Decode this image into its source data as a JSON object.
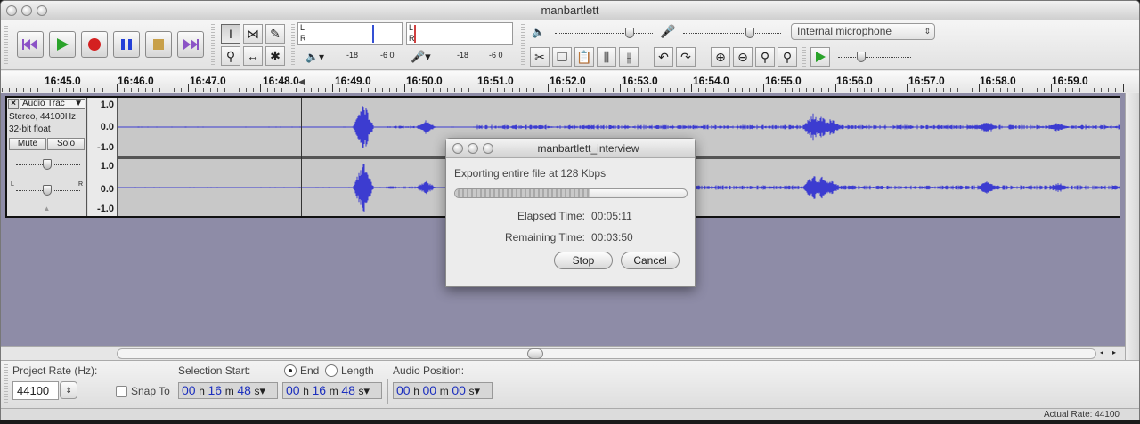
{
  "window": {
    "title": "manbartlett"
  },
  "meters": {
    "left": "L",
    "right": "R",
    "db18": "-18",
    "db6": "-6 0"
  },
  "mixer": {
    "input_source": "Internal microphone"
  },
  "ruler": {
    "ticks": [
      "16:45.0",
      "16:46.0",
      "16:47.0",
      "16:48.0",
      "16:49.0",
      "16:50.0",
      "16:51.0",
      "16:52.0",
      "16:53.0",
      "16:54.0",
      "16:55.0",
      "16:56.0",
      "16:57.0",
      "16:58.0",
      "16:59.0"
    ]
  },
  "track": {
    "name": "Audio Trac",
    "info1": "Stereo, 44100Hz",
    "info2": "32-bit float",
    "mute": "Mute",
    "solo": "Solo",
    "pan_l": "L",
    "pan_r": "R",
    "vruler": [
      "1.0",
      "0.0",
      "-1.0",
      "1.0",
      "0.0",
      "-1.0"
    ]
  },
  "dialog": {
    "title": "manbartlett_interview",
    "message": "Exporting entire file at 128 Kbps",
    "progress": 0.58,
    "elapsed_label": "Elapsed Time:",
    "elapsed_value": "00:05:11",
    "remaining_label": "Remaining Time:",
    "remaining_value": "00:03:50",
    "stop": "Stop",
    "cancel": "Cancel"
  },
  "selection": {
    "project_rate_label": "Project Rate (Hz):",
    "project_rate": "44100",
    "snap_to": "Snap To",
    "selection_start_label": "Selection Start:",
    "end_label": "End",
    "length_label": "Length",
    "audio_position_label": "Audio Position:",
    "start": {
      "h": "00",
      "m": "16",
      "s": "48"
    },
    "end": {
      "h": "00",
      "m": "16",
      "s": "48"
    },
    "position": {
      "h": "00",
      "m": "00",
      "s": "00"
    },
    "unit_h": "h",
    "unit_m": "m",
    "unit_s": "s"
  },
  "status": {
    "actual_rate": "Actual Rate: 44100"
  }
}
